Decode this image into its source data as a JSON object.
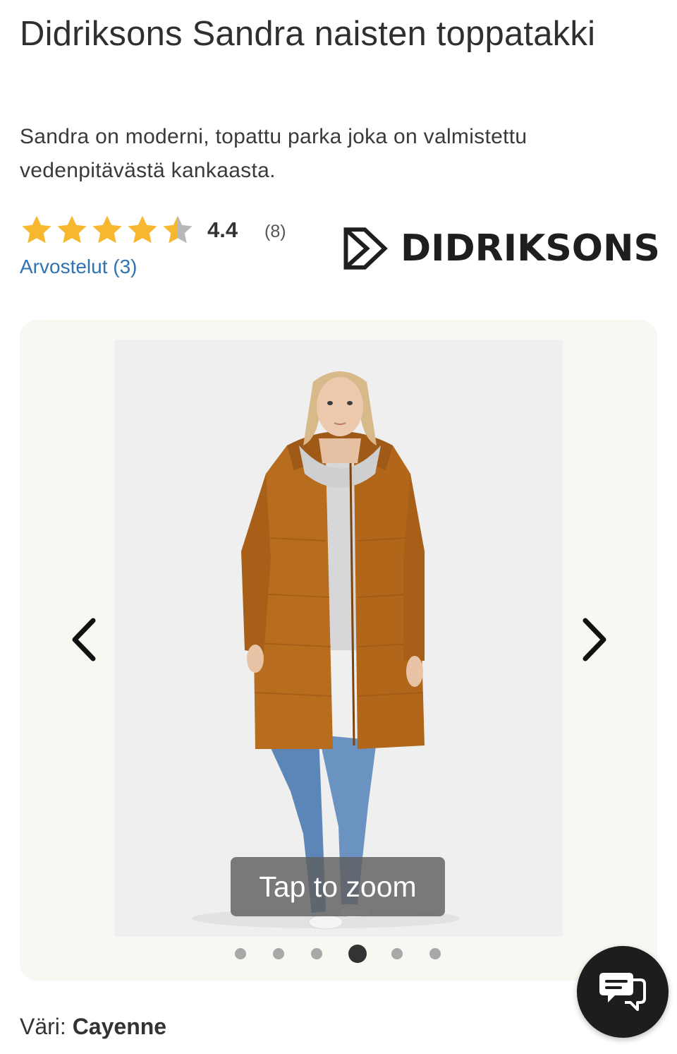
{
  "product": {
    "title": "Didriksons Sandra naisten toppatakki",
    "description": "Sandra on moderni, topattu parka joka on valmistettu vedenpitävästä kankaasta."
  },
  "rating": {
    "stars": 4.4,
    "value": "4.4",
    "count": "(8)",
    "reviews_link": "Arvostelut (3)",
    "star_color": "#f7b82f",
    "empty_star_color": "#b8b8b8"
  },
  "brand": {
    "name": "DIDRIKSONS"
  },
  "gallery": {
    "zoom_hint": "Tap to zoom",
    "prev_icon": "chevron-left-icon",
    "next_icon": "chevron-right-icon",
    "dot_count": 6,
    "active_dot": 4
  },
  "chat": {
    "icon": "chat-bubbles-icon"
  },
  "color": {
    "label": "Väri:",
    "value": "Cayenne"
  },
  "colors": {
    "link": "#2f73b3",
    "jacket": "#b86c1e",
    "jeans": "#5c86b8"
  }
}
